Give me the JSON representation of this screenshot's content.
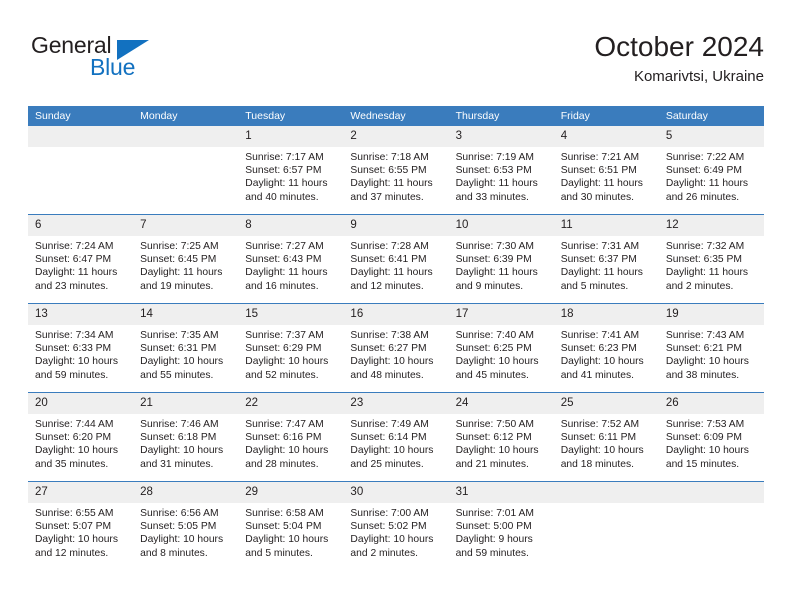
{
  "brand": {
    "name_part1": "General",
    "name_part2": "Blue",
    "triangle_color": "#1271c0",
    "logo_icon": "triangle-flag-icon"
  },
  "header": {
    "title": "October 2024",
    "location": "Komarivtsi, Ukraine"
  },
  "colors": {
    "header_blue": "#3a7cbd",
    "daynum_gray": "#efefef",
    "text": "#231f20",
    "brand_blue": "#1271c0"
  },
  "weekdays": [
    "Sunday",
    "Monday",
    "Tuesday",
    "Wednesday",
    "Thursday",
    "Friday",
    "Saturday"
  ],
  "weeks": [
    [
      {
        "day": "",
        "sunrise": "",
        "sunset": "",
        "daylight1": "",
        "daylight2": ""
      },
      {
        "day": "",
        "sunrise": "",
        "sunset": "",
        "daylight1": "",
        "daylight2": ""
      },
      {
        "day": "1",
        "sunrise": "Sunrise: 7:17 AM",
        "sunset": "Sunset: 6:57 PM",
        "daylight1": "Daylight: 11 hours",
        "daylight2": "and 40 minutes."
      },
      {
        "day": "2",
        "sunrise": "Sunrise: 7:18 AM",
        "sunset": "Sunset: 6:55 PM",
        "daylight1": "Daylight: 11 hours",
        "daylight2": "and 37 minutes."
      },
      {
        "day": "3",
        "sunrise": "Sunrise: 7:19 AM",
        "sunset": "Sunset: 6:53 PM",
        "daylight1": "Daylight: 11 hours",
        "daylight2": "and 33 minutes."
      },
      {
        "day": "4",
        "sunrise": "Sunrise: 7:21 AM",
        "sunset": "Sunset: 6:51 PM",
        "daylight1": "Daylight: 11 hours",
        "daylight2": "and 30 minutes."
      },
      {
        "day": "5",
        "sunrise": "Sunrise: 7:22 AM",
        "sunset": "Sunset: 6:49 PM",
        "daylight1": "Daylight: 11 hours",
        "daylight2": "and 26 minutes."
      }
    ],
    [
      {
        "day": "6",
        "sunrise": "Sunrise: 7:24 AM",
        "sunset": "Sunset: 6:47 PM",
        "daylight1": "Daylight: 11 hours",
        "daylight2": "and 23 minutes."
      },
      {
        "day": "7",
        "sunrise": "Sunrise: 7:25 AM",
        "sunset": "Sunset: 6:45 PM",
        "daylight1": "Daylight: 11 hours",
        "daylight2": "and 19 minutes."
      },
      {
        "day": "8",
        "sunrise": "Sunrise: 7:27 AM",
        "sunset": "Sunset: 6:43 PM",
        "daylight1": "Daylight: 11 hours",
        "daylight2": "and 16 minutes."
      },
      {
        "day": "9",
        "sunrise": "Sunrise: 7:28 AM",
        "sunset": "Sunset: 6:41 PM",
        "daylight1": "Daylight: 11 hours",
        "daylight2": "and 12 minutes."
      },
      {
        "day": "10",
        "sunrise": "Sunrise: 7:30 AM",
        "sunset": "Sunset: 6:39 PM",
        "daylight1": "Daylight: 11 hours",
        "daylight2": "and 9 minutes."
      },
      {
        "day": "11",
        "sunrise": "Sunrise: 7:31 AM",
        "sunset": "Sunset: 6:37 PM",
        "daylight1": "Daylight: 11 hours",
        "daylight2": "and 5 minutes."
      },
      {
        "day": "12",
        "sunrise": "Sunrise: 7:32 AM",
        "sunset": "Sunset: 6:35 PM",
        "daylight1": "Daylight: 11 hours",
        "daylight2": "and 2 minutes."
      }
    ],
    [
      {
        "day": "13",
        "sunrise": "Sunrise: 7:34 AM",
        "sunset": "Sunset: 6:33 PM",
        "daylight1": "Daylight: 10 hours",
        "daylight2": "and 59 minutes."
      },
      {
        "day": "14",
        "sunrise": "Sunrise: 7:35 AM",
        "sunset": "Sunset: 6:31 PM",
        "daylight1": "Daylight: 10 hours",
        "daylight2": "and 55 minutes."
      },
      {
        "day": "15",
        "sunrise": "Sunrise: 7:37 AM",
        "sunset": "Sunset: 6:29 PM",
        "daylight1": "Daylight: 10 hours",
        "daylight2": "and 52 minutes."
      },
      {
        "day": "16",
        "sunrise": "Sunrise: 7:38 AM",
        "sunset": "Sunset: 6:27 PM",
        "daylight1": "Daylight: 10 hours",
        "daylight2": "and 48 minutes."
      },
      {
        "day": "17",
        "sunrise": "Sunrise: 7:40 AM",
        "sunset": "Sunset: 6:25 PM",
        "daylight1": "Daylight: 10 hours",
        "daylight2": "and 45 minutes."
      },
      {
        "day": "18",
        "sunrise": "Sunrise: 7:41 AM",
        "sunset": "Sunset: 6:23 PM",
        "daylight1": "Daylight: 10 hours",
        "daylight2": "and 41 minutes."
      },
      {
        "day": "19",
        "sunrise": "Sunrise: 7:43 AM",
        "sunset": "Sunset: 6:21 PM",
        "daylight1": "Daylight: 10 hours",
        "daylight2": "and 38 minutes."
      }
    ],
    [
      {
        "day": "20",
        "sunrise": "Sunrise: 7:44 AM",
        "sunset": "Sunset: 6:20 PM",
        "daylight1": "Daylight: 10 hours",
        "daylight2": "and 35 minutes."
      },
      {
        "day": "21",
        "sunrise": "Sunrise: 7:46 AM",
        "sunset": "Sunset: 6:18 PM",
        "daylight1": "Daylight: 10 hours",
        "daylight2": "and 31 minutes."
      },
      {
        "day": "22",
        "sunrise": "Sunrise: 7:47 AM",
        "sunset": "Sunset: 6:16 PM",
        "daylight1": "Daylight: 10 hours",
        "daylight2": "and 28 minutes."
      },
      {
        "day": "23",
        "sunrise": "Sunrise: 7:49 AM",
        "sunset": "Sunset: 6:14 PM",
        "daylight1": "Daylight: 10 hours",
        "daylight2": "and 25 minutes."
      },
      {
        "day": "24",
        "sunrise": "Sunrise: 7:50 AM",
        "sunset": "Sunset: 6:12 PM",
        "daylight1": "Daylight: 10 hours",
        "daylight2": "and 21 minutes."
      },
      {
        "day": "25",
        "sunrise": "Sunrise: 7:52 AM",
        "sunset": "Sunset: 6:11 PM",
        "daylight1": "Daylight: 10 hours",
        "daylight2": "and 18 minutes."
      },
      {
        "day": "26",
        "sunrise": "Sunrise: 7:53 AM",
        "sunset": "Sunset: 6:09 PM",
        "daylight1": "Daylight: 10 hours",
        "daylight2": "and 15 minutes."
      }
    ],
    [
      {
        "day": "27",
        "sunrise": "Sunrise: 6:55 AM",
        "sunset": "Sunset: 5:07 PM",
        "daylight1": "Daylight: 10 hours",
        "daylight2": "and 12 minutes."
      },
      {
        "day": "28",
        "sunrise": "Sunrise: 6:56 AM",
        "sunset": "Sunset: 5:05 PM",
        "daylight1": "Daylight: 10 hours",
        "daylight2": "and 8 minutes."
      },
      {
        "day": "29",
        "sunrise": "Sunrise: 6:58 AM",
        "sunset": "Sunset: 5:04 PM",
        "daylight1": "Daylight: 10 hours",
        "daylight2": "and 5 minutes."
      },
      {
        "day": "30",
        "sunrise": "Sunrise: 7:00 AM",
        "sunset": "Sunset: 5:02 PM",
        "daylight1": "Daylight: 10 hours",
        "daylight2": "and 2 minutes."
      },
      {
        "day": "31",
        "sunrise": "Sunrise: 7:01 AM",
        "sunset": "Sunset: 5:00 PM",
        "daylight1": "Daylight: 9 hours",
        "daylight2": "and 59 minutes."
      },
      {
        "day": "",
        "sunrise": "",
        "sunset": "",
        "daylight1": "",
        "daylight2": ""
      },
      {
        "day": "",
        "sunrise": "",
        "sunset": "",
        "daylight1": "",
        "daylight2": ""
      }
    ]
  ]
}
